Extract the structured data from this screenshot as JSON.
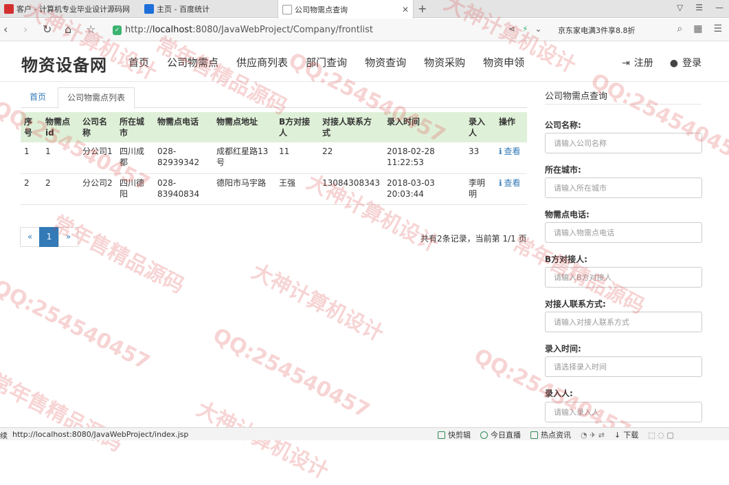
{
  "browser": {
    "tabs": [
      {
        "title": "客户 - 计算机专业毕业设计源码网",
        "icon_color": "#d32f2f"
      },
      {
        "title": "主页 - 百度统计",
        "icon_color": "#1e6fd9"
      },
      {
        "title": "公司物需点查询",
        "icon_color": "#bbbbbb"
      }
    ],
    "url_prefix": "http://",
    "url_host": "localhost",
    "url_rest": ":8080/JavaWebProject/Company/frontlist",
    "promo": "京东家电满3件享8.8折",
    "status_url": "http://localhost:8080/JavaWebProject/index.jsp",
    "status_left": "续",
    "status_items": [
      "快剪辑",
      "今日直播",
      "热点资讯",
      "下载"
    ]
  },
  "site": {
    "brand": "物资设备网",
    "nav": [
      "首页",
      "公司物需点",
      "供应商列表",
      "部门查询",
      "物资查询",
      "物资采购",
      "物资申领"
    ],
    "register": "注册",
    "login": "登录"
  },
  "breadcrumb": {
    "home": "首页",
    "current": "公司物需点列表"
  },
  "table": {
    "headers": [
      "序号",
      "物需点id",
      "公司名称",
      "所在城市",
      "物需点电话",
      "物需点地址",
      "B方对接人",
      "对接人联系方式",
      "录入时间",
      "录入人",
      "操作"
    ],
    "rows": [
      [
        "1",
        "1",
        "分公司1",
        "四川成都",
        "028-82939342",
        "成都红星路13号",
        "11",
        "22",
        "2018-02-28 11:22:53",
        "33",
        "查看"
      ],
      [
        "2",
        "2",
        "分公司2",
        "四川德阳",
        "028-83940834",
        "德阳市马宇路",
        "王强",
        "13084308343",
        "2018-03-03 20:03:44",
        "李明明",
        "查看"
      ]
    ]
  },
  "pager": {
    "prev": "«",
    "current": "1",
    "next": "»",
    "info": "共有2条记录，当前第 1/1 页"
  },
  "query": {
    "title": "公司物需点查询",
    "fields": [
      {
        "label": "公司名称:",
        "placeholder": "请输入公司名称"
      },
      {
        "label": "所在城市:",
        "placeholder": "请输入所在城市"
      },
      {
        "label": "物需点电话:",
        "placeholder": "请输入物需点电话"
      },
      {
        "label": "B方对接人:",
        "placeholder": "请输入B方对接人"
      },
      {
        "label": "对接人联系方式:",
        "placeholder": "请输入对接人联系方式"
      },
      {
        "label": "录入时间:",
        "placeholder": "请选择录入时间"
      },
      {
        "label": "录入人:",
        "placeholder": "请输入录入人"
      }
    ]
  },
  "watermark": [
    "大神计算机设计",
    "常年售精品源码",
    "QQ:254540457"
  ]
}
